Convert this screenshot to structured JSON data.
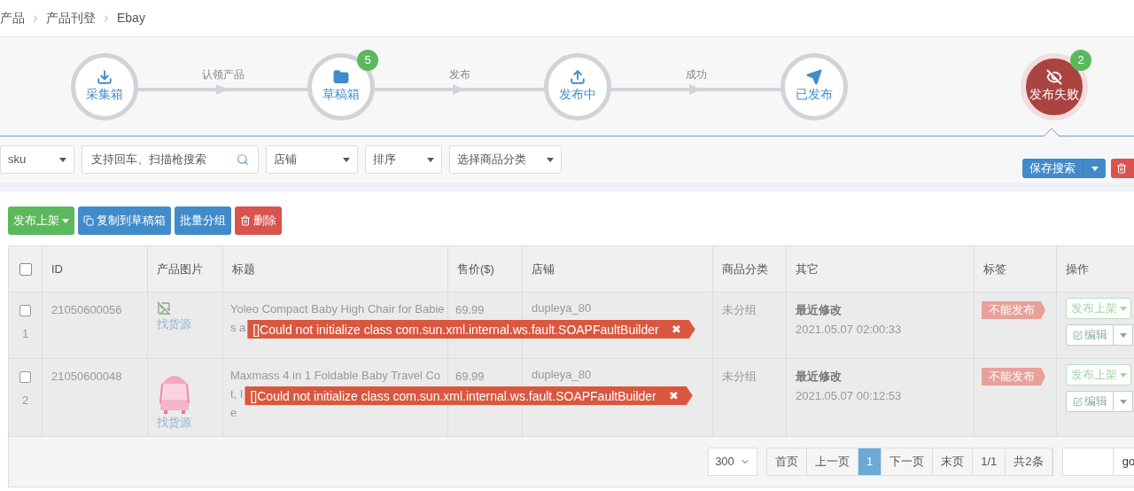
{
  "breadcrumb": [
    "产品",
    "产品刊登",
    "Ebay"
  ],
  "steps": [
    {
      "label": "采集箱",
      "selected": false,
      "connector": "认领产品"
    },
    {
      "label": "草稿箱",
      "selected": false,
      "badge": "5",
      "connector": "发布"
    },
    {
      "label": "发布中",
      "selected": false,
      "connector": "成功"
    },
    {
      "label": "已发布",
      "selected": false
    },
    {
      "label": "发布失败",
      "selected": true,
      "badge": "2"
    }
  ],
  "filters": [
    {
      "kind": "select",
      "value": "sku"
    },
    {
      "kind": "search",
      "placeholder": "支持回车、扫描枪搜索"
    },
    {
      "kind": "select",
      "value": "店铺"
    },
    {
      "kind": "select",
      "value": "排序"
    },
    {
      "kind": "select",
      "value": "选择商品分类"
    }
  ],
  "save_search": "保存搜索",
  "actions": [
    {
      "label": "发布上架",
      "color": "#5cb85c",
      "caret": true
    },
    {
      "label": "复制到草稿箱",
      "color": "#428bca",
      "caret": false
    },
    {
      "label": "批量分组",
      "color": "#428bca",
      "caret": false
    },
    {
      "label": "删除",
      "color": "#d9534f",
      "caret": false
    }
  ],
  "table": {
    "all_checked": false,
    "columns": [
      "ID",
      "产品图片",
      "标题",
      "售价($)",
      "店铺",
      "商品分类",
      "其它",
      "标签",
      "操作"
    ],
    "rows": [
      {
        "checked": false,
        "index": "1",
        "id": "21050600056",
        "source_link": "找货源",
        "title_lines": [
          "Yoleo Compact Baby High Chair for Babie",
          "s a"
        ],
        "error": "[]Could not initialize class com.sun.xml.internal.ws.fault.SOAPFaultBuilder",
        "error_close": "✖",
        "price": "69.99",
        "shop": "dupleya_80",
        "category": "未分组",
        "other_label": "最近修改",
        "other_time": "2021.05.07 02:00:33",
        "tag": "不能发布",
        "publish": "发布上架",
        "edit": "编辑"
      },
      {
        "checked": false,
        "index": "2",
        "id": "21050600048",
        "source_link": "找货源",
        "title_lines": [
          "Maxmass 4 in 1 Foldable Baby Travel Co",
          "t, I",
          "e"
        ],
        "error": "[]Could not initialize class com.sun.xml.internal.ws.fault.SOAPFaultBuilder",
        "error_close": "✖",
        "price": "69.99",
        "shop": "dupleya_80",
        "category": "未分组",
        "other_label": "最近修改",
        "other_time": "2021.05.07 00:12:53",
        "tag": "不能发布",
        "publish": "发布上架",
        "edit": "编辑"
      }
    ]
  },
  "pagination": {
    "page_size": "300",
    "buttons": [
      {
        "label": "首页",
        "selected": false
      },
      {
        "label": "上一页",
        "selected": false
      },
      {
        "label": "1",
        "selected": true
      },
      {
        "label": "下一页",
        "selected": false
      },
      {
        "label": "末页",
        "selected": false
      },
      {
        "label": "1/1",
        "selected": false
      },
      {
        "label": "共2条",
        "selected": false
      }
    ],
    "go": "go"
  }
}
